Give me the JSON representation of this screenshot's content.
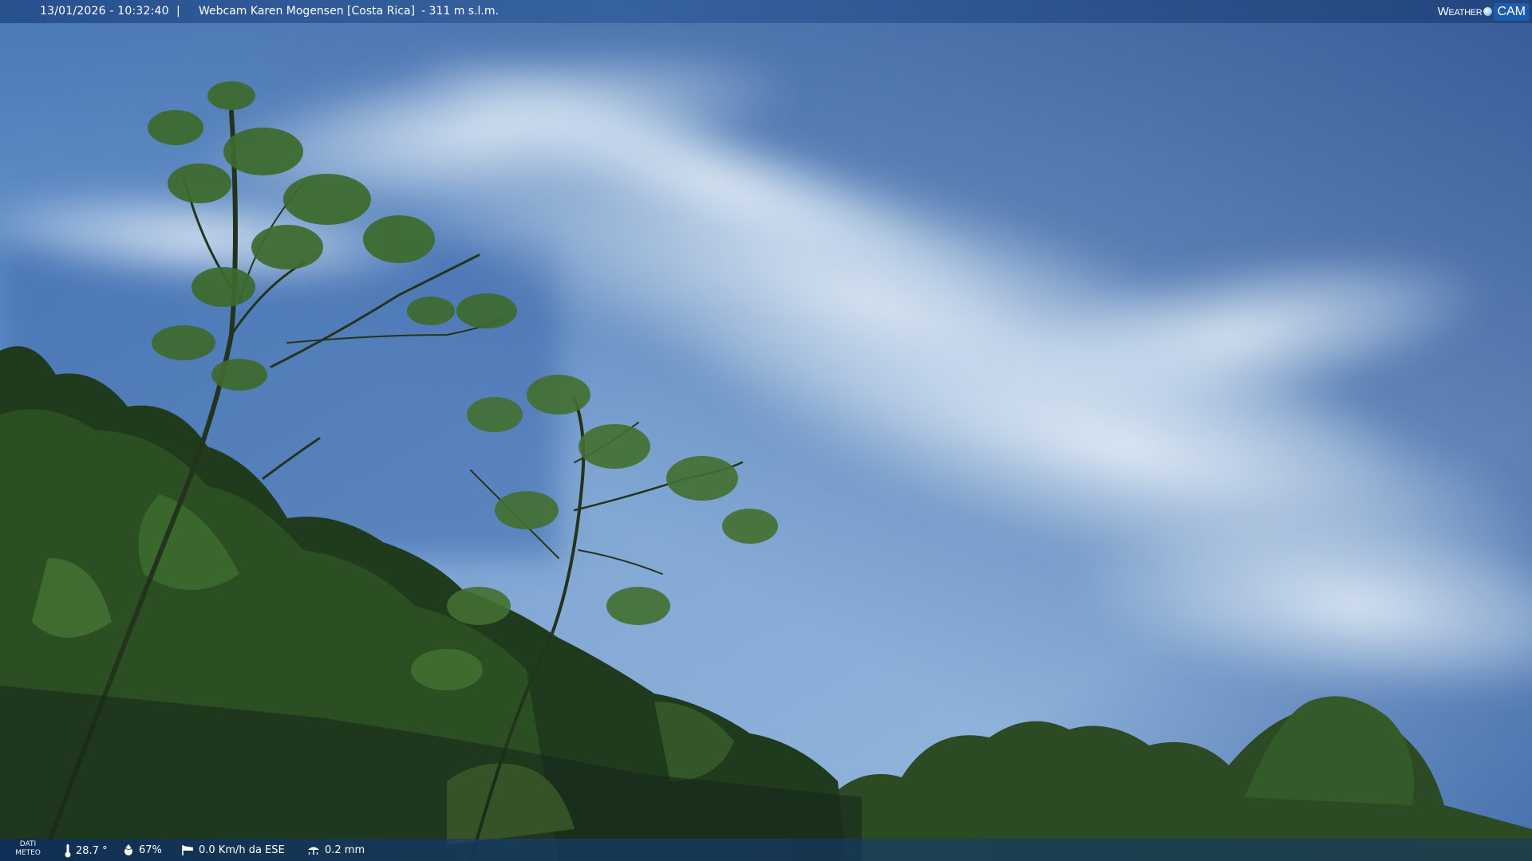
{
  "header": {
    "datetime": "13/01/2026 - 10:32:40",
    "separator": "|",
    "title": "Webcam Karen Mogensen [Costa Rica]",
    "altitude": "- 311 m s.l.m.",
    "logo_weather": "Weather",
    "logo_cam": "CAM"
  },
  "footer": {
    "label_line1": "DATI",
    "label_line2": "METEO",
    "temperature": "28.7 °",
    "humidity": "67%",
    "wind": "0.0 Km/h da ESE",
    "rain": "0.2 mm"
  },
  "icons": {
    "temperature": "thermometer-icon",
    "humidity": "droplet-icon",
    "wind": "windsock-icon",
    "rain": "rain-icon"
  },
  "colors": {
    "bar": "#1e4682",
    "sky": "#3a6aa8",
    "foliage": "#2a4a1e"
  }
}
